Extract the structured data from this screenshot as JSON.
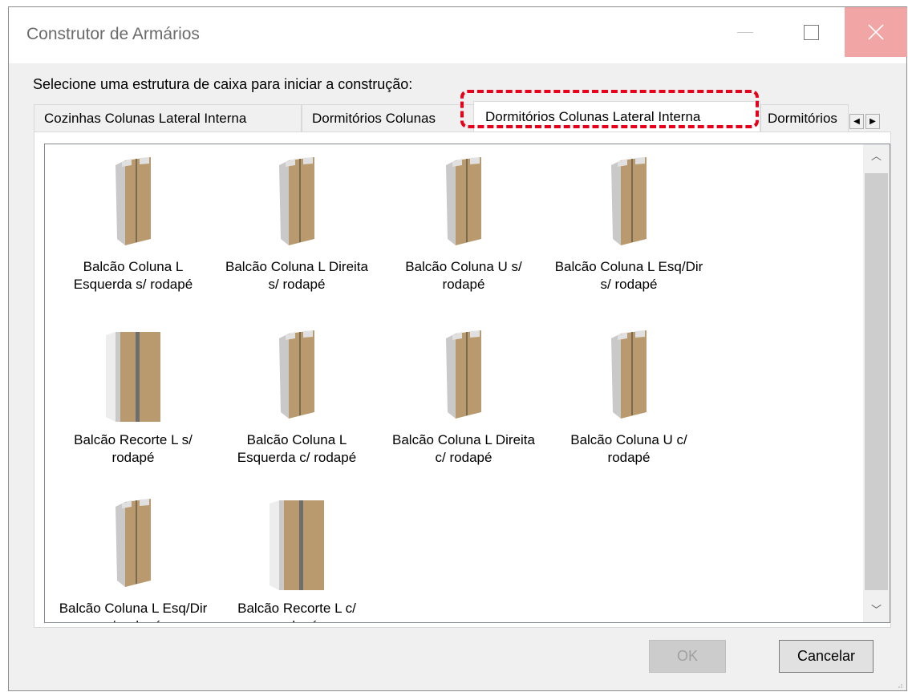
{
  "window": {
    "title": "Construtor de Armários"
  },
  "instruction": "Selecione uma estrutura de caixa para iniciar a construção:",
  "tabs": [
    {
      "label": "Cozinhas Colunas Lateral Interna"
    },
    {
      "label": "Dormitórios Colunas"
    },
    {
      "label": "Dormitórios Colunas Lateral Interna",
      "selected": true
    },
    {
      "label": "Dormitórios"
    }
  ],
  "items": [
    {
      "label": "Balcão Coluna L Esquerda s/ rodapé",
      "icon": "cabinet-column-l-left-icon"
    },
    {
      "label": "Balcão Coluna L Direita s/ rodapé",
      "icon": "cabinet-column-l-right-icon"
    },
    {
      "label": "Balcão Coluna U s/ rodapé",
      "icon": "cabinet-column-u-icon"
    },
    {
      "label": "Balcão Coluna L Esq/Dir s/ rodapé",
      "icon": "cabinet-column-l-both-icon"
    },
    {
      "label": "Balcão Recorte L s/ rodapé",
      "icon": "cabinet-cutout-l-icon"
    },
    {
      "label": "Balcão Coluna L Esquerda c/ rodapé",
      "icon": "cabinet-column-l-left-icon"
    },
    {
      "label": "Balcão Coluna L Direita c/ rodapé",
      "icon": "cabinet-column-l-right-icon"
    },
    {
      "label": "Balcão Coluna U c/ rodapé",
      "icon": "cabinet-column-u-icon"
    },
    {
      "label": "Balcão Coluna L Esq/Dir s/ rodapé",
      "icon": "cabinet-column-l-both-icon"
    },
    {
      "label": "Balcão Recorte L c/ rodapé",
      "icon": "cabinet-cutout-l-icon"
    }
  ],
  "buttons": {
    "ok": "OK",
    "cancel": "Cancelar"
  },
  "colors": {
    "highlight": "#e8001a",
    "close_hover": "#f1a5a5",
    "wood": "#b89a6e",
    "panel_gray": "#c9c9c9"
  }
}
